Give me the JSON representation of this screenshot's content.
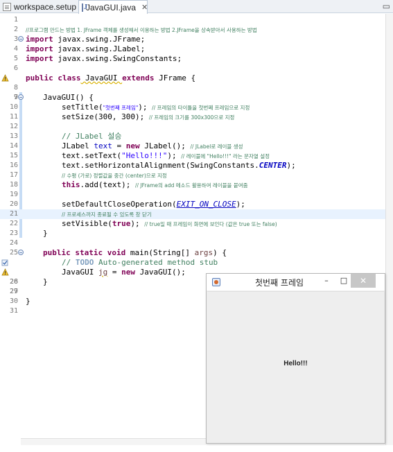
{
  "tabs": [
    {
      "label": "workspace.setup",
      "icon": "text-file-icon"
    },
    {
      "label": "JavaGUI.java",
      "icon": "java-file-icon",
      "close": "✕"
    }
  ],
  "window_control": "▭",
  "editor": {
    "line_numbers": [
      "1",
      "2",
      "3",
      "4",
      "5",
      "6",
      "7",
      "8",
      "9",
      "10",
      "11",
      "12",
      "13",
      "14",
      "15",
      "16",
      "17",
      "18",
      "19",
      "20",
      "21",
      "22",
      "23",
      "24",
      "25",
      "26",
      "27",
      "28",
      "29",
      "30",
      "31"
    ],
    "code": {
      "l2_comment": "//프로그램 만드는 방법 1. JFrame 객체를 생성해서 이용하는 방법 2.JFrame을 상속받아서 사용하는 방법",
      "import_kw": "import",
      "l3_rest": " javax.swing.JFrame;",
      "l4_rest": " javax.swing.JLabel;",
      "l5_rest": " javax.swing.SwingConstants;",
      "l7_public": "public",
      "l7_class": "class",
      "l7_name": " JavaGUI ",
      "l7_extends": "extends",
      "l7_rest": " JFrame {",
      "l9": "JavaGUI() {",
      "l10_a": "setTitle(",
      "l10_str": "\"첫번째 프레임\"",
      "l10_b": "); ",
      "l10_cmt": "// 프레임의 타이틀을 첫번째 프레임으로 지정",
      "l11_a": "setSize(300, 300); ",
      "l11_cmt": "// 프레임의 크기를 300x300으로 지정",
      "l13_cmt": "// JLabel 설승",
      "l14_a": "JLabel ",
      "l14_var": "text",
      "l14_b": " = ",
      "l14_new": "new",
      "l14_c": " JLabel(); ",
      "l14_cmt": "// JLabel로 레이블 생성",
      "l15_a": "text.setText(",
      "l15_str": "\"Hello!!!\"",
      "l15_b": "); ",
      "l15_cmt": "// 레이블에 \"Hello!!!\" 라는 문자열 설정",
      "l16_a": "text.setHorizontalAlignment(SwingConstants.",
      "l16_fld": "CENTER",
      "l16_b": ");",
      "l17_cmt": "// 수평 (가로) 정렬값을 중간 (center)으로 지정",
      "l18_this": "this",
      "l18_a": ".add(text); ",
      "l18_cmt": "// JFrame의 add 메소드 활용하여 레이블을 붙여줌",
      "l20_a": "setDefaultCloseOperation(",
      "l20_fld": "EXIT_ON_CLOSE",
      "l20_b": ");",
      "l21_cmt": "// 프로세스까지 종료될 수 있도록 창 닫기",
      "l22_a": "setVisible(",
      "l22_true": "true",
      "l22_b": "); ",
      "l22_cmt": "// true일 때 프레임이 화면에 보인다 (값은 true 또는 false)",
      "l23": "}",
      "l25_public": "public",
      "l25_static": "static",
      "l25_void": "void",
      "l25_a": " main(String[] ",
      "l25_args": "args",
      "l25_b": ") {",
      "l26_cmt": "// ",
      "l26_todo": "TODO",
      "l26_rest": " Auto-generated method stub",
      "l27_a": "JavaGUI ",
      "l27_var": "jg",
      "l27_b": " = ",
      "l27_new": "new",
      "l27_c": " JavaGUI();",
      "l28": "}",
      "l30": "}"
    }
  },
  "frame": {
    "title": "첫번째 프레임",
    "minimize": "–",
    "maximize": "□",
    "close": "✕",
    "label": "Hello!!!"
  }
}
